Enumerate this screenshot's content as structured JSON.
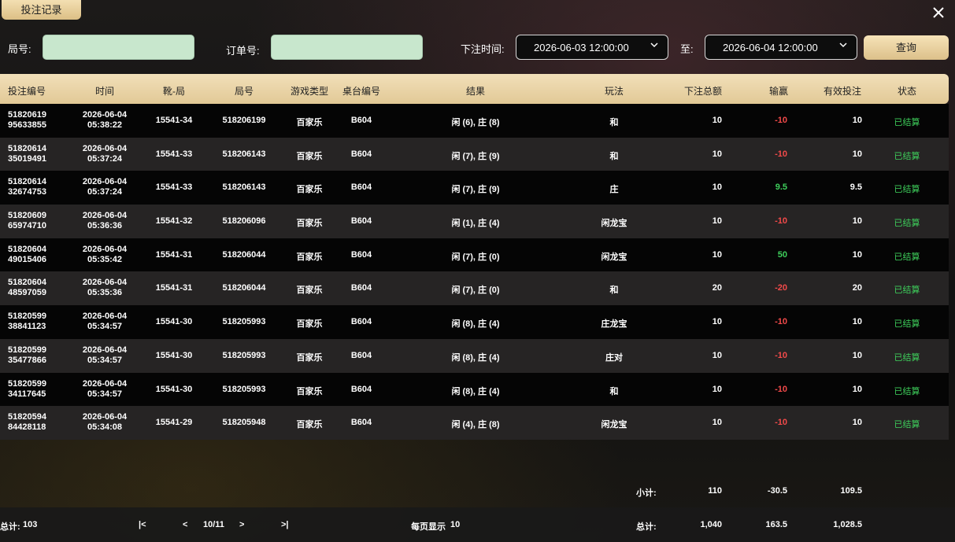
{
  "title": "投注记录",
  "filters": {
    "round_label": "局号:",
    "order_label": "订单号:",
    "time_label": "下注时间:",
    "to_label": "至:",
    "start_time": "2026-06-03 12:00:00",
    "end_time": "2026-06-04 12:00:00",
    "query_label": "查询"
  },
  "columns": [
    "投注编号",
    "时间",
    "靴-局",
    "局号",
    "游戏类型",
    "桌台编号",
    "结果",
    "玩法",
    "下注总额",
    "输赢",
    "有效投注",
    "状态"
  ],
  "rows": [
    {
      "id1": "51820619",
      "id2": "95633855",
      "date": "2026-06-04",
      "time": "05:38:22",
      "shoe": "15541-34",
      "round": "518206199",
      "game": "百家乐",
      "table": "B604",
      "result": "闲 (6), 庄 (8)",
      "play": "和",
      "bet": "10",
      "win": "-10",
      "valid": "10",
      "status": "已结算"
    },
    {
      "id1": "51820614",
      "id2": "35019491",
      "date": "2026-06-04",
      "time": "05:37:24",
      "shoe": "15541-33",
      "round": "518206143",
      "game": "百家乐",
      "table": "B604",
      "result": "闲 (7), 庄 (9)",
      "play": "和",
      "bet": "10",
      "win": "-10",
      "valid": "10",
      "status": "已结算"
    },
    {
      "id1": "51820614",
      "id2": "32674753",
      "date": "2026-06-04",
      "time": "05:37:24",
      "shoe": "15541-33",
      "round": "518206143",
      "game": "百家乐",
      "table": "B604",
      "result": "闲 (7), 庄 (9)",
      "play": "庄",
      "bet": "10",
      "win": "9.5",
      "valid": "9.5",
      "status": "已结算"
    },
    {
      "id1": "51820609",
      "id2": "65974710",
      "date": "2026-06-04",
      "time": "05:36:36",
      "shoe": "15541-32",
      "round": "518206096",
      "game": "百家乐",
      "table": "B604",
      "result": "闲 (1), 庄 (4)",
      "play": "闲龙宝",
      "bet": "10",
      "win": "-10",
      "valid": "10",
      "status": "已结算"
    },
    {
      "id1": "51820604",
      "id2": "49015406",
      "date": "2026-06-04",
      "time": "05:35:42",
      "shoe": "15541-31",
      "round": "518206044",
      "game": "百家乐",
      "table": "B604",
      "result": "闲 (7), 庄 (0)",
      "play": "闲龙宝",
      "bet": "10",
      "win": "50",
      "valid": "10",
      "status": "已结算"
    },
    {
      "id1": "51820604",
      "id2": "48597059",
      "date": "2026-06-04",
      "time": "05:35:36",
      "shoe": "15541-31",
      "round": "518206044",
      "game": "百家乐",
      "table": "B604",
      "result": "闲 (7), 庄 (0)",
      "play": "和",
      "bet": "20",
      "win": "-20",
      "valid": "20",
      "status": "已结算"
    },
    {
      "id1": "51820599",
      "id2": "38841123",
      "date": "2026-06-04",
      "time": "05:34:57",
      "shoe": "15541-30",
      "round": "518205993",
      "game": "百家乐",
      "table": "B604",
      "result": "闲 (8), 庄 (4)",
      "play": "庄龙宝",
      "bet": "10",
      "win": "-10",
      "valid": "10",
      "status": "已结算"
    },
    {
      "id1": "51820599",
      "id2": "35477866",
      "date": "2026-06-04",
      "time": "05:34:57",
      "shoe": "15541-30",
      "round": "518205993",
      "game": "百家乐",
      "table": "B604",
      "result": "闲 (8), 庄 (4)",
      "play": "庄对",
      "bet": "10",
      "win": "-10",
      "valid": "10",
      "status": "已结算"
    },
    {
      "id1": "51820599",
      "id2": "34117645",
      "date": "2026-06-04",
      "time": "05:34:57",
      "shoe": "15541-30",
      "round": "518205993",
      "game": "百家乐",
      "table": "B604",
      "result": "闲 (8), 庄 (4)",
      "play": "和",
      "bet": "10",
      "win": "-10",
      "valid": "10",
      "status": "已结算"
    },
    {
      "id1": "51820594",
      "id2": "84428118",
      "date": "2026-06-04",
      "time": "05:34:08",
      "shoe": "15541-29",
      "round": "518205948",
      "game": "百家乐",
      "table": "B604",
      "result": "闲 (4), 庄 (8)",
      "play": "闲龙宝",
      "bet": "10",
      "win": "-10",
      "valid": "10",
      "status": "已结算"
    }
  ],
  "subtotal": {
    "label": "小计:",
    "bet": "110",
    "win": "-30.5",
    "valid": "109.5"
  },
  "total": {
    "label": "总计:",
    "bet": "1,040",
    "win": "163.5",
    "valid": "1,028.5"
  },
  "footer": {
    "count_label": "总计:",
    "count_value": "103",
    "first": "|<",
    "prev": "<",
    "page": "10/11",
    "next": ">",
    "last": ">|",
    "per_page_label": "每页显示",
    "per_page_value": "10"
  },
  "colors": {
    "header_gold": "#e8d19f",
    "positive": "#3ecf5b",
    "negative": "#f34a4a",
    "input_bg": "#c8e7cd"
  }
}
